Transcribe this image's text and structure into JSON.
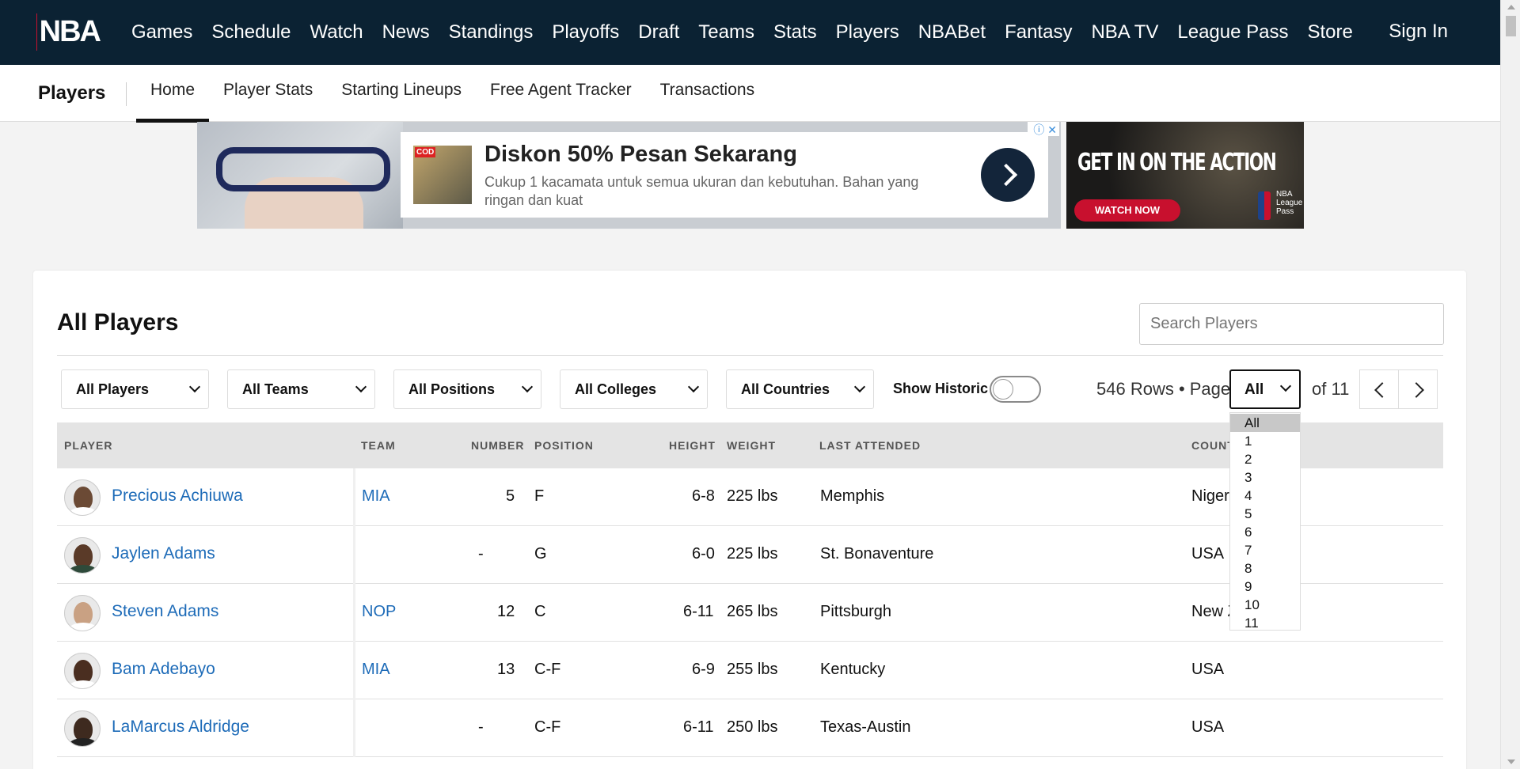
{
  "nav": {
    "logo_text": "NBA",
    "links": [
      "Games",
      "Schedule",
      "Watch",
      "News",
      "Standings",
      "Playoffs",
      "Draft",
      "Teams",
      "Stats",
      "Players",
      "NBABet",
      "Fantasy",
      "NBA TV",
      "League Pass",
      "Store"
    ],
    "sign_in": "Sign In"
  },
  "subnav": {
    "title": "Players",
    "tabs": [
      "Home",
      "Player Stats",
      "Starting Lineups",
      "Free Agent Tracker",
      "Transactions"
    ],
    "active_tab": "Home"
  },
  "ad1": {
    "badge": "COD",
    "headline": "Diskon 50% Pesan Sekarang",
    "description": "Cukup 1 kacamata untuk semua ukuran dan kebutuhan. Bahan yang ringan dan kuat"
  },
  "ad2": {
    "headline": "GET IN ON THE ACTION",
    "button": "WATCH NOW",
    "brand": "NBA League Pass"
  },
  "section": {
    "title": "All Players",
    "search_placeholder": "Search Players"
  },
  "filters": {
    "players": "All Players",
    "teams": "All Teams",
    "positions": "All Positions",
    "colleges": "All Colleges",
    "countries": "All Countries",
    "show_historic_label": "Show Historic",
    "show_historic": false
  },
  "pagination": {
    "rows_info": "546 Rows • Page",
    "current_page": "All",
    "of_pages": "of 11",
    "options": [
      "All",
      "1",
      "2",
      "3",
      "4",
      "5",
      "6",
      "7",
      "8",
      "9",
      "10",
      "11"
    ]
  },
  "table": {
    "columns": [
      "PLAYER",
      "TEAM",
      "NUMBER",
      "POSITION",
      "HEIGHT",
      "WEIGHT",
      "LAST ATTENDED",
      "COUNTRY"
    ],
    "rows": [
      {
        "player": "Precious Achiuwa",
        "team": "MIA",
        "number": "5",
        "position": "F",
        "height": "6-8",
        "weight": "225 lbs",
        "last_attended": "Memphis",
        "country": "Nigeria"
      },
      {
        "player": "Jaylen Adams",
        "team": "",
        "number": "-",
        "position": "G",
        "height": "6-0",
        "weight": "225 lbs",
        "last_attended": "St. Bonaventure",
        "country": "USA"
      },
      {
        "player": "Steven Adams",
        "team": "NOP",
        "number": "12",
        "position": "C",
        "height": "6-11",
        "weight": "265 lbs",
        "last_attended": "Pittsburgh",
        "country": "New Zealand"
      },
      {
        "player": "Bam Adebayo",
        "team": "MIA",
        "number": "13",
        "position": "C-F",
        "height": "6-9",
        "weight": "255 lbs",
        "last_attended": "Kentucky",
        "country": "USA"
      },
      {
        "player": "LaMarcus Aldridge",
        "team": "",
        "number": "-",
        "position": "C-F",
        "height": "6-11",
        "weight": "250 lbs",
        "last_attended": "Texas-Austin",
        "country": "USA"
      }
    ]
  },
  "colors": {
    "nav_bg": "#0b2233",
    "link": "#1d6bb8",
    "header_bg": "#e4e4e4"
  }
}
